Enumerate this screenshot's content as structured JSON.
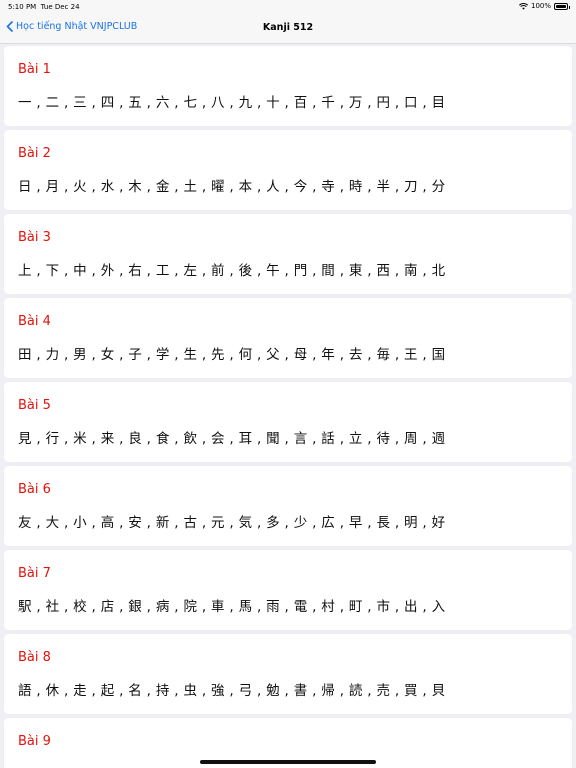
{
  "status_bar": {
    "time": "5:10 PM",
    "date": "Tue Dec 24",
    "battery_text": "100%",
    "battery_level": 1.0
  },
  "navbar": {
    "back_label": "Học tiếng Nhật VNJPCLUB",
    "title": "Kanji 512"
  },
  "lessons": [
    {
      "title": "Bài 1",
      "kanji": "一 , 二 , 三 , 四 , 五 , 六 , 七 , 八 , 九 , 十 , 百 , 千 , 万 , 円 , 口 , 目"
    },
    {
      "title": "Bài 2",
      "kanji": "日 , 月 , 火 , 水 , 木 , 金 , 土 , 曜 , 本 , 人 , 今 , 寺 , 時 , 半 , 刀 , 分"
    },
    {
      "title": "Bài 3",
      "kanji": "上 , 下 , 中 , 外 , 右 , 工 , 左 , 前 , 後 , 午 , 門 , 間 , 東 , 西 , 南 , 北"
    },
    {
      "title": "Bài 4",
      "kanji": "田 , 力 , 男 , 女 , 子 , 学 , 生 , 先 , 何 , 父 , 母 , 年 , 去 , 毎 , 王 , 国"
    },
    {
      "title": "Bài 5",
      "kanji": "見 , 行 , 米 , 来 , 良 , 食 , 飲 , 会 , 耳 , 聞 , 言 , 話 , 立 , 待 , 周 , 週"
    },
    {
      "title": "Bài 6",
      "kanji": "友 , 大 , 小 , 高 , 安 , 新 , 古 , 元 , 気 , 多 , 少 , 広 , 早 , 長 , 明 , 好"
    },
    {
      "title": "Bài 7",
      "kanji": "駅 , 社 , 校 , 店 , 銀 , 病 , 院 , 車 , 馬 , 雨 , 電 , 村 , 町 , 市 , 出 , 入"
    },
    {
      "title": "Bài 8",
      "kanji": "語 , 休 , 走 , 起 , 名 , 持 , 虫 , 強 , 弓 , 勉 , 書 , 帰 , 読 , 売 , 買 , 貝"
    },
    {
      "title": "Bài 9",
      "kanji": ""
    }
  ]
}
